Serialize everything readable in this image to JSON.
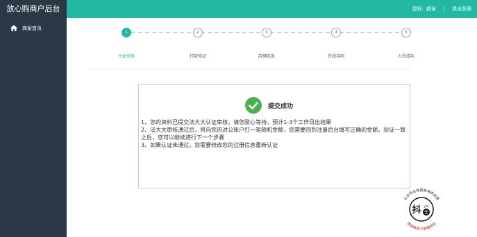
{
  "app": {
    "title": "放心购商户后台"
  },
  "header": {
    "greeting": "您好:",
    "username": "颜舍",
    "separator": "|",
    "logout": "退出登录"
  },
  "sidebar": {
    "items": [
      {
        "label": "商家首页",
        "icon": "home-icon"
      }
    ]
  },
  "steps": [
    {
      "number": "1",
      "label": "主体信息",
      "active": true
    },
    {
      "number": "2",
      "label": "打款验证",
      "active": false
    },
    {
      "number": "3",
      "label": "店铺信息",
      "active": false
    },
    {
      "number": "4",
      "label": "在线合同",
      "active": false
    },
    {
      "number": "5",
      "label": "入驻成功",
      "active": false
    }
  ],
  "result": {
    "title": "提交成功",
    "lines": [
      "1、您的资料已提交法大大认证审核，请您耐心等待，预计1-3个工作日出结果",
      "2、法大大审核通过后，将向您的对公账户打一笔随机金额，您需要回到注册后台填写正确的金额，验证一致之后，您可以继续进行下一个步骤",
      "3、如果认证未通过，您需要修改您的注册信息重新认证"
    ]
  },
  "watermark": {
    "ring_top": "公众号名称颜舍电商运营",
    "ring_bottom": "颜舍电商·抖音服务站",
    "center_char": "抖",
    "center_small": "yan",
    "center_char2": "舍"
  },
  "colors": {
    "accent": "#23b8a4",
    "sidebar": "#2b3947"
  }
}
